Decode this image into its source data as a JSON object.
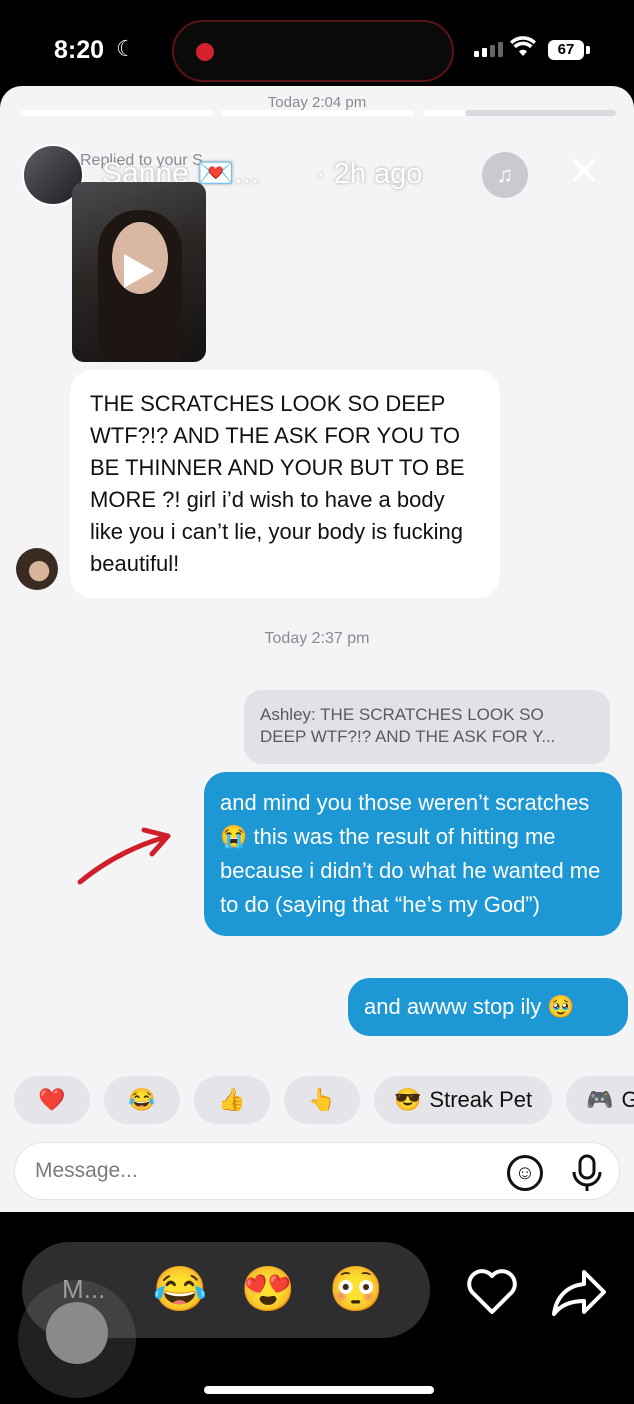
{
  "status_bar": {
    "time": "8:20",
    "battery": "67"
  },
  "story": {
    "timestamp": "Today 2:04 pm",
    "replied_label": "Replied to your S...",
    "user_name": "Sanne 💌...",
    "age": "· 2h ago"
  },
  "messages": {
    "incoming_text": "THE SCRATCHES LOOK SO DEEP WTF?!? AND THE ASK FOR YOU TO BE THINNER AND YOUR BUT TO BE MORE ?! girl i’d wish to have a body like you i can’t lie, your body is fucking beautiful!",
    "mid_timestamp": "Today 2:37 pm",
    "quote_text": "Ashley: THE SCRATCHES LOOK SO DEEP WTF?!? AND THE ASK FOR Y...",
    "outgoing_1": "and mind you those weren’t scratches 😭 this was the result of hitting me because i didn’t do what he wanted me to do (saying that “he’s my God”)",
    "outgoing_2": "and awww stop ily 🥹"
  },
  "reactions": [
    {
      "emoji": "❤️"
    },
    {
      "emoji": "😂"
    },
    {
      "emoji": "👍"
    },
    {
      "emoji": "👆"
    },
    {
      "emoji": "😎",
      "label": "Streak Pet"
    },
    {
      "emoji": "🎮",
      "label": "Ga"
    }
  ],
  "composer": {
    "placeholder": "Message..."
  },
  "bottom_bar": {
    "placeholder": "M...",
    "emojis": [
      "😂",
      "😍",
      "😳"
    ]
  },
  "colors": {
    "outgoing_bubble": "#1d98d4",
    "annotation_arrow": "#d11e2a",
    "record_dot": "#d3202a"
  },
  "icons": [
    "moon-icon",
    "wifi-icon",
    "music-icon",
    "close-icon",
    "play-icon",
    "sticker-icon",
    "mic-icon",
    "heart-icon",
    "share-icon"
  ]
}
